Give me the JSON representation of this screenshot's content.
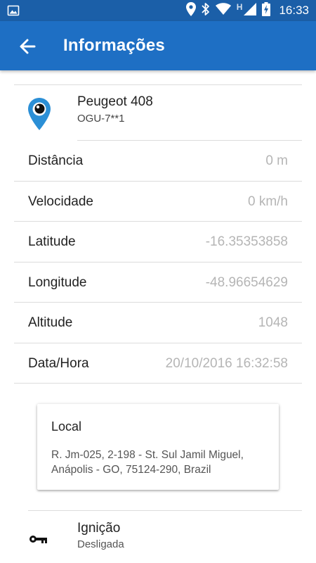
{
  "status_bar": {
    "time": "16:33",
    "network_letter": "H",
    "icons": [
      "image-icon",
      "location-icon",
      "bluetooth-icon",
      "wifi-icon",
      "signal-icon",
      "battery-charging-icon"
    ]
  },
  "app_bar": {
    "title": "Informações",
    "back_icon": "arrow-back-icon"
  },
  "vehicle": {
    "name": "Peugeot 408",
    "plate": "OGU-7**1",
    "icon": "map-pin-icon"
  },
  "details": [
    {
      "label": "Distância",
      "value": "0 m"
    },
    {
      "label": "Velocidade",
      "value": "0 km/h"
    },
    {
      "label": "Latitude",
      "value": "-16.35353858"
    },
    {
      "label": "Longitude",
      "value": "-48.96654629"
    },
    {
      "label": "Altitude",
      "value": "1048"
    },
    {
      "label": "Data/Hora",
      "value": "20/10/2016 16:32:58"
    }
  ],
  "local_card": {
    "title": "Local",
    "address": "R. Jm-025, 2-198 - St. Sul Jamil Miguel, Anápolis - GO, 75124-290, Brazil"
  },
  "ignition": {
    "label": "Ignição",
    "value": "Desligada",
    "icon": "key-icon"
  },
  "colors": {
    "status_bar": "#1b5fa8",
    "app_bar": "#1e6fc4",
    "pin_blue": "#2b8fd6",
    "value_gray": "#b5b5b5"
  }
}
